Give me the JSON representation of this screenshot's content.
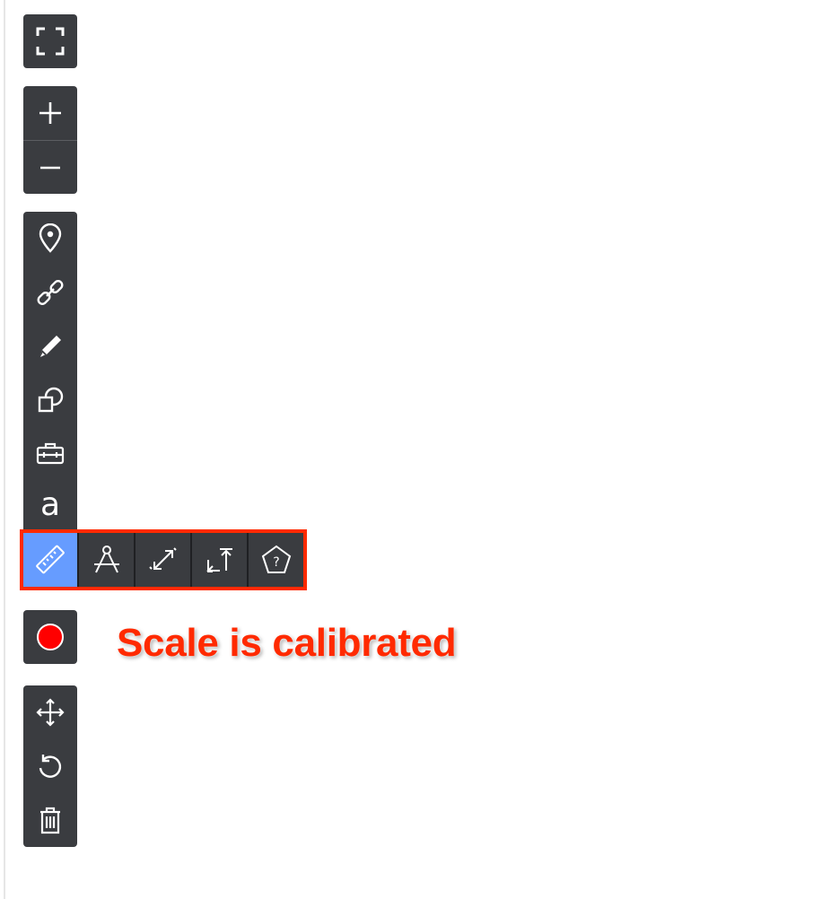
{
  "toolbar": {
    "fullscreen": {
      "icon": "fullscreen-icon"
    },
    "zoom": {
      "zoom_in_icon": "plus-icon",
      "zoom_out_icon": "minus-icon"
    },
    "tools": {
      "marker_icon": "map-pin-icon",
      "link_icon": "link-icon",
      "draw_icon": "pencil-icon",
      "shapes_icon": "shapes-icon",
      "toolbox_icon": "toolbox-icon",
      "text_label": "a"
    },
    "measure": {
      "active_tool": "ruler",
      "tools": [
        "ruler-icon",
        "compass-icon",
        "scale-arrows-icon",
        "height-arrow-icon",
        "polygon-help-icon"
      ],
      "highlight_color": "#ff2a00",
      "active_color": "#669cff"
    },
    "record": {
      "icon": "record-dot-icon",
      "color": "#ff0000"
    },
    "edit": {
      "move_icon": "move-icon",
      "rotate_icon": "rotate-icon",
      "delete_icon": "trash-icon"
    }
  },
  "annotation": {
    "caption": "Scale is calibrated",
    "color": "#ff2a00"
  }
}
